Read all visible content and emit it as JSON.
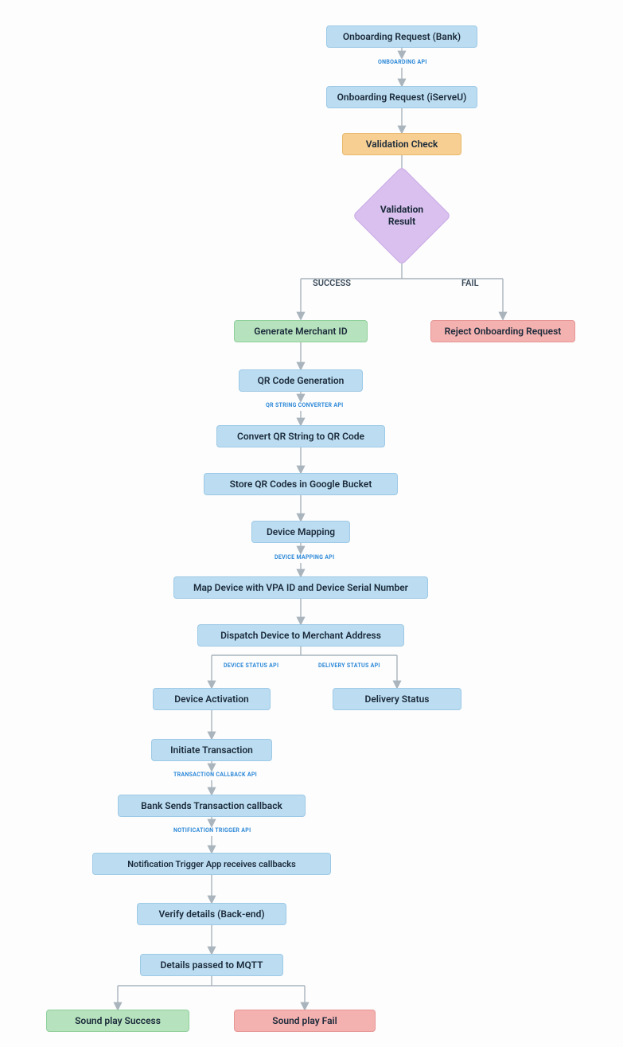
{
  "nodes": {
    "onboard_bank": "Onboarding Request (Bank)",
    "onboard_iserveu": "Onboarding Request (iServeU)",
    "validation_check": "Validation Check",
    "validation_result": "Validation\nResult",
    "generate_merchant": "Generate Merchant ID",
    "reject_request": "Reject Onboarding Request",
    "qr_gen": "QR Code Generation",
    "convert_qr": "Convert QR String to QR Code",
    "store_qr": "Store QR Codes in Google Bucket",
    "device_mapping": "Device Mapping",
    "map_device": "Map Device with VPA ID and Device Serial Number",
    "dispatch": "Dispatch Device to Merchant Address",
    "device_activation": "Device Activation",
    "delivery_status": "Delivery Status",
    "initiate_txn": "Initiate Transaction",
    "bank_callback": "Bank Sends Transaction callback",
    "notif_trigger": "Notification Trigger App receives callbacks",
    "verify_backend": "Verify details (Back-end)",
    "mqtt": "Details passed to MQTT",
    "sound_success": "Sound play Success",
    "sound_fail": "Sound play Fail"
  },
  "api_labels": {
    "onboarding_api": "ONBOARDING API",
    "qr_string_api": "QR STRING CONVERTER API",
    "device_mapping_api": "DEVICE MAPPING API",
    "device_status_api": "DEVICE STATUS API",
    "delivery_status_api": "DELIVERY STATUS API",
    "txn_callback_api": "TRANSACTION CALLBACK API",
    "notif_trigger_api": "NOTIFICATION TRIGGER API"
  },
  "branch_labels": {
    "success": "SUCCESS",
    "fail": "FAIL"
  },
  "colors": {
    "blue": "#bcddf1",
    "orange": "#f7cf93",
    "purple": "#d9c0ee",
    "green": "#b6e2bd",
    "red": "#f3b1b0",
    "api_text": "#2c88d8",
    "arrow": "#a9b4bd"
  }
}
